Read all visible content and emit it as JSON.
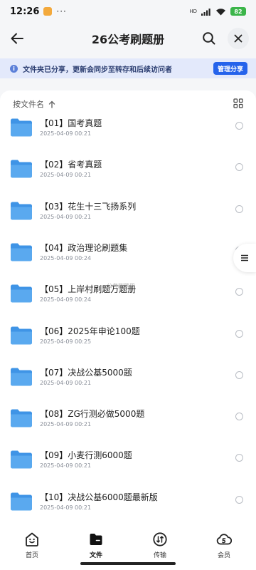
{
  "status_bar": {
    "time": "12:26",
    "dots": "···",
    "signal_label": "HD",
    "battery": "82"
  },
  "header": {
    "title": "26公考刷题册"
  },
  "notice": {
    "info_glyph": "i",
    "text": "文件夹已分享，更新会同步至转存和后续访问者",
    "action_label": "管理分享"
  },
  "sort": {
    "label": "按文件名"
  },
  "files": [
    {
      "name": "【01】国考真题",
      "date": "2025-04-09 00:21"
    },
    {
      "name": "【02】省考真题",
      "date": "2025-04-09 00:21"
    },
    {
      "name": "【03】花生十三飞扬系列",
      "date": "2025-04-09 00:21"
    },
    {
      "name": "【04】政治理论刷题集",
      "date": "2025-04-09 00:24"
    },
    {
      "name": "【05】上岸村刷题万题册",
      "date": "2025-04-09 00:24"
    },
    {
      "name": "【06】2025年申论100题",
      "date": "2025-04-09 00:25"
    },
    {
      "name": "【07】决战公基5000题",
      "date": "2025-04-09 00:21"
    },
    {
      "name": "【08】ZG行测必做5000题",
      "date": "2025-04-09 00:21"
    },
    {
      "name": "【09】小麦行测6000题",
      "date": "2025-04-09 00:21"
    },
    {
      "name": "【10】决战公基6000题最新版",
      "date": "2025-04-09 00:21"
    }
  ],
  "watermark": "公考刷题册",
  "nav": {
    "items": [
      {
        "label": "首页",
        "icon": "home-face-icon"
      },
      {
        "label": "文件",
        "icon": "file-icon"
      },
      {
        "label": "传输",
        "icon": "transfer-icon"
      },
      {
        "label": "会员",
        "icon": "member-icon"
      }
    ],
    "active": "文件"
  },
  "colors": {
    "accent": "#2563eb",
    "notice_bg": "#e3e9fb",
    "folder": "#4a9ee8",
    "battery": "#3bb54a"
  }
}
